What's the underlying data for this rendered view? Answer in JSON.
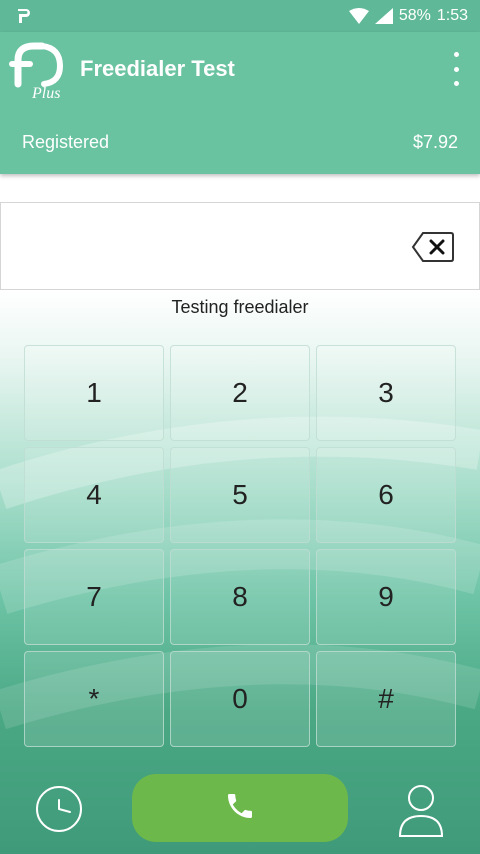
{
  "status_bar": {
    "battery": "58%",
    "time": "1:53"
  },
  "app_bar": {
    "title": "Freedialer Test",
    "logo_text": "Plus",
    "registration_status": "Registered",
    "balance": "$7.92"
  },
  "dialer": {
    "number_value": "",
    "caller_label": "Testing freedialer",
    "keys": [
      "1",
      "2",
      "3",
      "4",
      "5",
      "6",
      "7",
      "8",
      "9",
      "*",
      "0",
      "#"
    ]
  },
  "icons": {
    "backspace": "backspace-icon",
    "call": "phone-icon",
    "history": "clock-icon",
    "contacts": "person-icon",
    "menu": "more-vert-icon"
  },
  "colors": {
    "status_bar": "#5fb998",
    "app_bar": "#69c2a0",
    "call_button": "#6db84a"
  }
}
